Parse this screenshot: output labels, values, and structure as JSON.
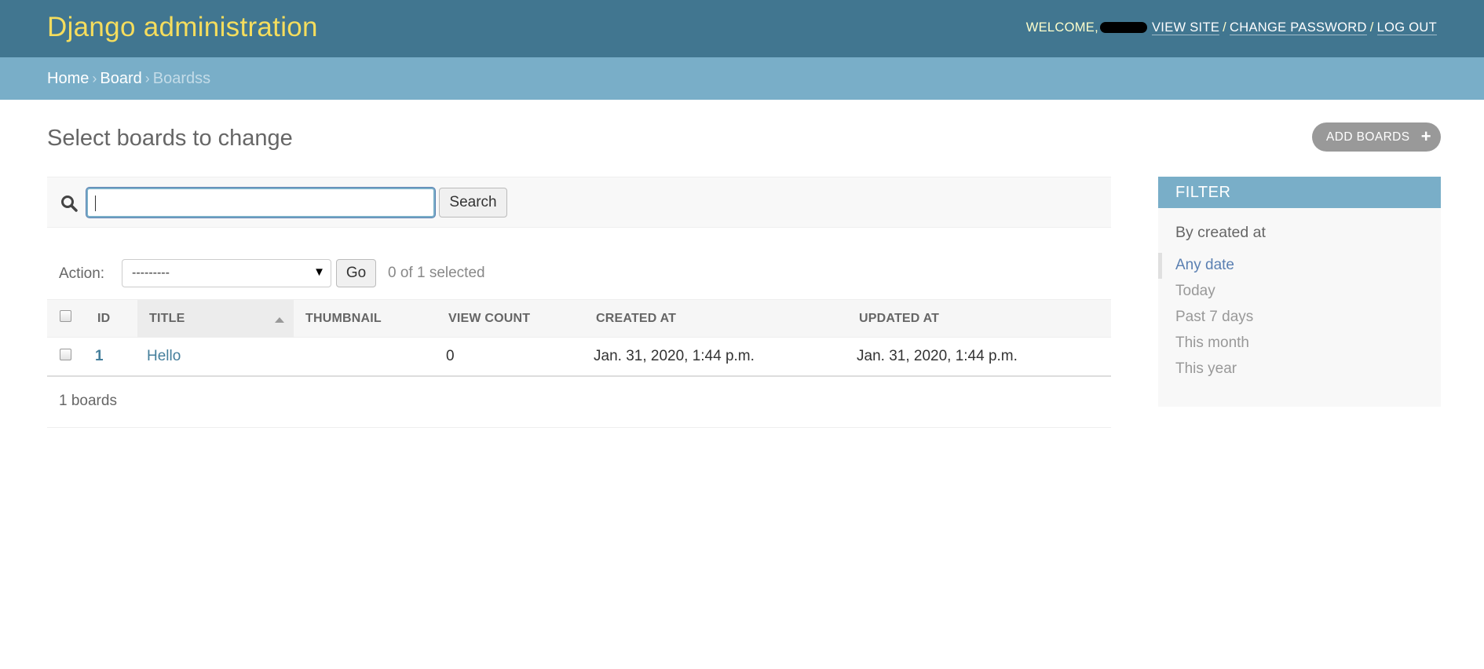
{
  "header": {
    "branding": "Django administration",
    "welcome": "WELCOME,",
    "view_site": "VIEW SITE",
    "change_password": "CHANGE PASSWORD",
    "log_out": "LOG OUT",
    "separator": "/"
  },
  "breadcrumbs": {
    "home": "Home",
    "app": "Board",
    "current": "Boardss",
    "separator": "›"
  },
  "page": {
    "title": "Select boards to change",
    "add_label": "ADD BOARDS",
    "add_icon": "+"
  },
  "search": {
    "value": "",
    "button": "Search"
  },
  "actions": {
    "label": "Action:",
    "selected_option": "---------",
    "go": "Go",
    "selected_count": "0 of 1 selected"
  },
  "table": {
    "columns": [
      "ID",
      "TITLE",
      "THUMBNAIL",
      "VIEW COUNT",
      "CREATED AT",
      "UPDATED AT"
    ],
    "rows": [
      {
        "id": "1",
        "title": "Hello",
        "thumbnail": "",
        "view_count": "0",
        "created_at": "Jan. 31, 2020, 1:44 p.m.",
        "updated_at": "Jan. 31, 2020, 1:44 p.m."
      }
    ],
    "footer": "1 boards"
  },
  "filter": {
    "header": "FILTER",
    "title": "By created at",
    "options": [
      "Any date",
      "Today",
      "Past 7 days",
      "This month",
      "This year"
    ]
  },
  "colors": {
    "header_bg": "#417690",
    "branding": "#f5dd5d",
    "breadcrumb_bg": "#79aec8",
    "link": "#447e9b",
    "selected_filter": "#5b80b2"
  }
}
